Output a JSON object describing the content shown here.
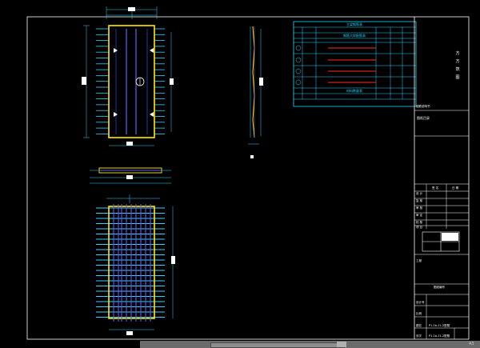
{
  "sheet": {
    "title_vertical": [
      "方",
      "方",
      "筑",
      "图"
    ],
    "corner_label": "A3"
  },
  "drawing_title": "P1-1b-11-2配筋",
  "param_table": {
    "title": "主梁钢筋表",
    "sub_title": "钢筋大样配筋表",
    "bottom_title": "材料数量表",
    "note_label": "钢筋说明书"
  },
  "title_block": {
    "section_label": "图纸目录",
    "rows": [
      "设 计",
      "复 核",
      "审 核",
      "审 定",
      "校 核",
      "项 目"
    ],
    "sign_label": "签 名",
    "date_label": "日 期",
    "project_label": "工程",
    "drawing_no_label": "图纸编号",
    "code_label": "设计号",
    "scale_label": "比例",
    "page_label": "页次",
    "name_label": "图名",
    "drawing_code": "P1-1b-11-2配筋"
  },
  "ui": {
    "corner": "A3"
  }
}
